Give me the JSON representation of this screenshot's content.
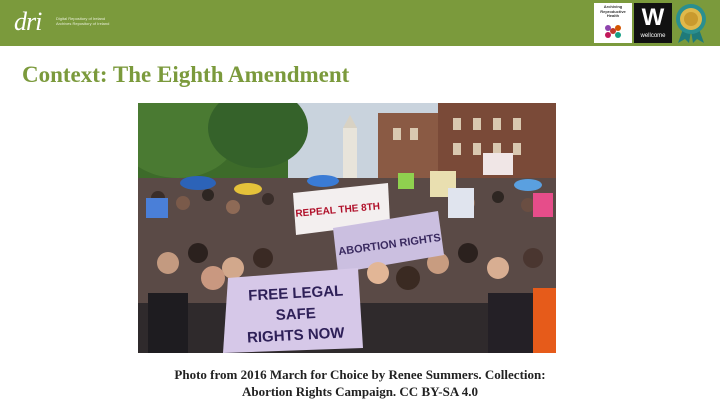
{
  "header": {
    "logo_mark": "dri",
    "logo_sub_lines": [
      "Digital Repository of Ireland",
      "Archives Repository of Ireland"
    ],
    "partner_logos": {
      "arh_text": "Archiving Reproductive Health",
      "wellcome_mark": "W",
      "wellcome_label": "wellcome"
    },
    "accent_color": "#7b9a3c"
  },
  "slide": {
    "title": "Context: The Eighth Amendment"
  },
  "photo": {
    "banner_left": "REPEAL THE 8TH",
    "banner_center": "ABORTION RIGHTS",
    "banner_front": [
      "FREE LEGAL",
      "SAFE",
      "RIGHTS NOW"
    ]
  },
  "caption": {
    "line1": "Photo from 2016 March for Choice by Renee Summers. Collection:",
    "line2": "Abortion Rights Campaign. CC BY-SA 4.0"
  }
}
